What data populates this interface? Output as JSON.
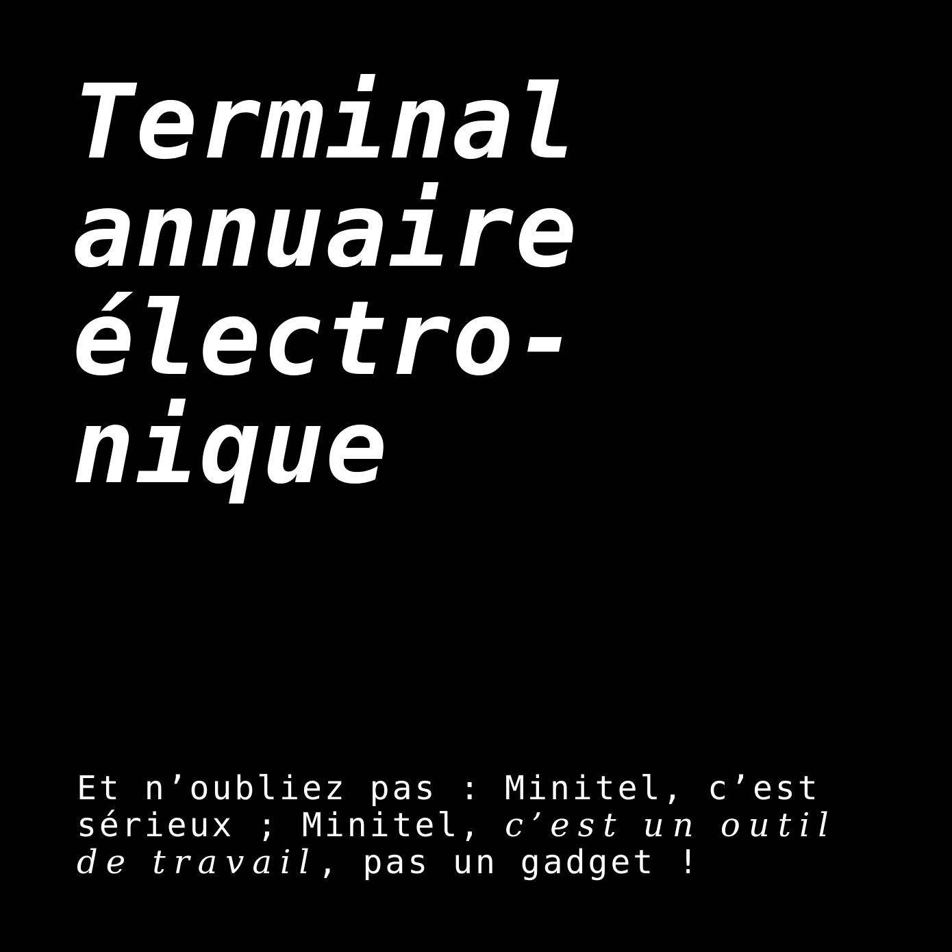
{
  "title": {
    "lines": [
      "Terminal",
      "annuaire",
      "électro-",
      "nique"
    ]
  },
  "body": {
    "line1": "Et n’oubliez pas : Minitel, c’est",
    "line2_roman": "sérieux ; Minitel, ",
    "line2_italic": "c’est un outil",
    "line3_italic": "de travail",
    "line3_roman": ", pas un gadget !"
  },
  "colors": {
    "background": "#000000",
    "text": "#ffffff"
  }
}
